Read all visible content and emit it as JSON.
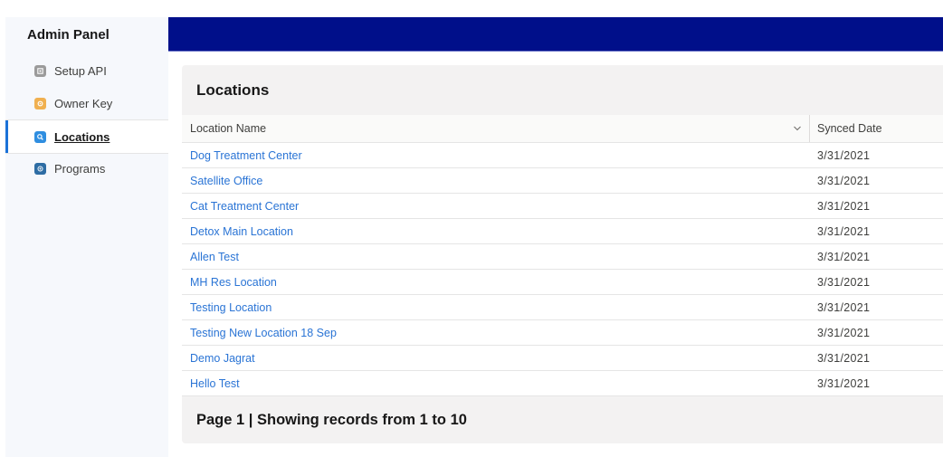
{
  "sidebar": {
    "title": "Admin Panel",
    "items": [
      {
        "label": "Setup API",
        "icon": "api-icon",
        "color": "#9b9b9b",
        "active": false
      },
      {
        "label": "Owner Key",
        "icon": "key-icon",
        "color": "#f0b050",
        "active": false
      },
      {
        "label": "Locations",
        "icon": "search-icon",
        "color": "#2f8ee0",
        "active": true
      },
      {
        "label": "Programs",
        "icon": "programs-icon",
        "color": "#2e6da4",
        "active": false
      }
    ]
  },
  "header": {
    "bar_color": "#000f8a"
  },
  "main": {
    "title": "Locations",
    "table": {
      "columns": [
        {
          "label": "Location Name",
          "sortable": true
        },
        {
          "label": "Synced Date"
        }
      ],
      "rows": [
        {
          "name": "Dog Treatment Center",
          "synced": "3/31/2021"
        },
        {
          "name": "Satellite Office",
          "synced": "3/31/2021"
        },
        {
          "name": "Cat Treatment Center",
          "synced": "3/31/2021"
        },
        {
          "name": "Detox Main Location",
          "synced": "3/31/2021"
        },
        {
          "name": "Allen Test",
          "synced": "3/31/2021"
        },
        {
          "name": "MH Res Location",
          "synced": "3/31/2021"
        },
        {
          "name": "Testing Location",
          "synced": "3/31/2021"
        },
        {
          "name": "Testing New Location 18 Sep",
          "synced": "3/31/2021"
        },
        {
          "name": "Demo Jagrat",
          "synced": "3/31/2021"
        },
        {
          "name": "Hello Test",
          "synced": "3/31/2021"
        }
      ]
    },
    "footer": "Page 1 | Showing records from 1 to 10"
  }
}
